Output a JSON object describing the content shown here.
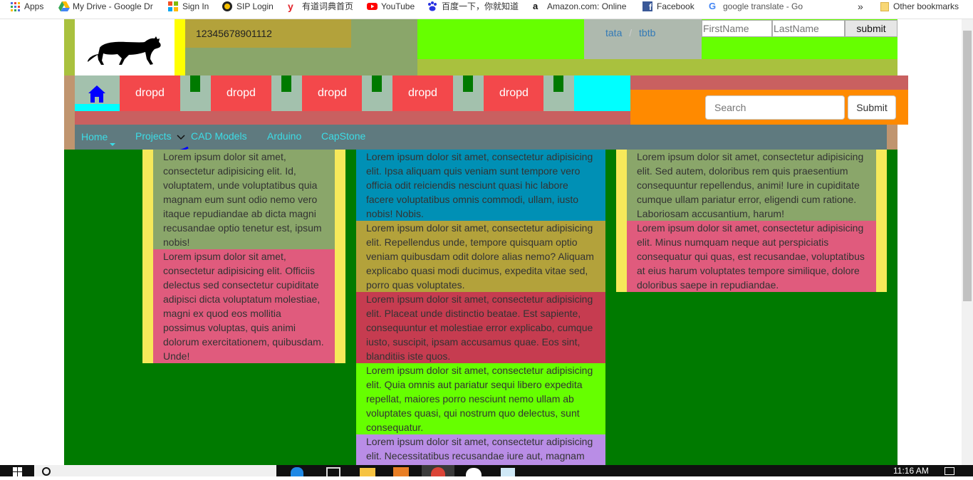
{
  "bookmarks": [
    {
      "label": "Apps",
      "icon": "apps-grid-icon"
    },
    {
      "label": "My Drive - Google Dr",
      "icon": "google-drive-icon"
    },
    {
      "label": "Sign In",
      "icon": "windows-logo-icon"
    },
    {
      "label": "SIP Login",
      "icon": "sip-logo-icon"
    },
    {
      "label": "有道词典首页",
      "icon": "youdao-icon"
    },
    {
      "label": "YouTube",
      "icon": "youtube-icon"
    },
    {
      "label": "百度一下，你就知道",
      "icon": "baidu-paw-icon"
    },
    {
      "label": "Amazon.com: Online",
      "icon": "amazon-icon"
    },
    {
      "label": "Facebook",
      "icon": "facebook-icon"
    },
    {
      "label": "google translate - Go",
      "icon": "google-g-icon"
    }
  ],
  "bookmarks_more": "»",
  "other_bookmarks": "Other bookmarks",
  "header": {
    "number_text": "12345678901112",
    "links": [
      "tata",
      "/",
      "tbtb"
    ],
    "firstname_placeholder": "FirstName",
    "lastname_placeholder": "LastName",
    "submit_label": "submit"
  },
  "navbar": {
    "dropdowns": [
      "dropd",
      "dropd",
      "dropd",
      "dropd",
      "dropd"
    ],
    "search_placeholder": "Search",
    "search_button": "Submit"
  },
  "menu": [
    "Home",
    "Projects",
    "CAD Models",
    "Arduino",
    "CapStone"
  ],
  "columns": {
    "left": [
      "Lorem ipsum dolor sit amet, consectetur adipisicing elit. Id, voluptatem, unde voluptatibus quia magnam eum sunt odio nemo vero itaque repudiandae ab dicta magni recusandae optio tenetur est, ipsum nobis!",
      "Lorem ipsum dolor sit amet, consectetur adipisicing elit. Officiis delectus sed consectetur cupiditate adipisci dicta voluptatum molestiae, magni ex quod eos mollitia possimus voluptas, quis animi dolorum exercitationem, quibusdam. Unde!"
    ],
    "middle": [
      "Lorem ipsum dolor sit amet, consectetur adipisicing elit. Ipsa aliquam quis veniam sunt tempore vero officia odit reiciendis nesciunt quasi hic labore facere voluptatibus omnis commodi, ullam, iusto nobis! Nobis.",
      "Lorem ipsum dolor sit amet, consectetur adipisicing elit. Repellendus unde, tempore quisquam optio veniam quibusdam odit dolore alias nemo? Aliquam explicabo quasi modi ducimus, expedita vitae sed, porro quas voluptates.",
      "Lorem ipsum dolor sit amet, consectetur adipisicing elit. Placeat unde distinctio beatae. Est sapiente, consequuntur et molestiae error explicabo, cumque iusto, suscipit, ipsam accusamus quae. Eos sint, blanditiis iste quos.",
      "Lorem ipsum dolor sit amet, consectetur adipisicing elit. Quia omnis aut pariatur sequi libero expedita repellat, maiores porro nesciunt nemo ullam ab voluptates quasi, qui nostrum quo delectus, sunt consequatur.",
      "Lorem ipsum dolor sit amet, consectetur adipisicing elit. Necessitatibus recusandae iure aut, magnam"
    ],
    "right": [
      "Lorem ipsum dolor sit amet, consectetur adipisicing elit. Sed autem, doloribus rem quis praesentium consequuntur repellendus, animi! Iure in cupiditate cumque ullam pariatur error, eligendi cum ratione. Laboriosam accusantium, harum!",
      "Lorem ipsum dolor sit amet, consectetur adipisicing elit. Minus numquam neque aut perspiciatis consequatur qui quas, est recusandae, voluptatibus at eius harum voluptates tempore similique, dolore doloribus saepe in repudiandae."
    ]
  },
  "taskbar": {
    "clock": "11:16 AM"
  },
  "colors": {
    "page_green": "#007a00",
    "lime": "#66ff00",
    "olive": "#a9c13e",
    "sage": "#8aa66a",
    "gold": "#b3a23b",
    "red": "#f3484b",
    "pink": "#e05b7d",
    "teal_blue": "#0090b5",
    "crimson": "#c63c50",
    "lilac": "#b98de6",
    "cyan": "#00ffff",
    "orange": "#ff8a00",
    "slate_nav": "#5f7a7f",
    "tan": "#c0956f",
    "yellow": "#f6e95a"
  }
}
